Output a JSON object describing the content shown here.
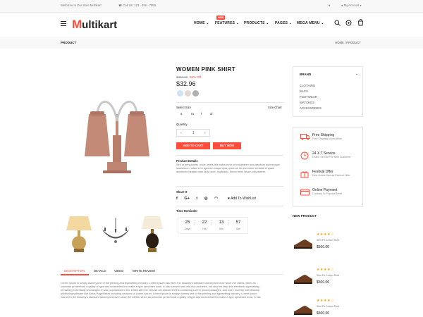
{
  "topbar": {
    "welcome": "Welcome to Our store Multikart",
    "phone": "Call Us: 123 - 456 - 7890",
    "account": "My Account"
  },
  "header": {
    "logo_first": "M",
    "logo_rest": "ultikart",
    "nav": [
      "HOME",
      "FEATURES",
      "PRODUCTS",
      "PAGES",
      "MEGA MENU"
    ],
    "new_badge": "NEW"
  },
  "breadcrumb": {
    "title": "PRODUCT",
    "path": "HOME / PRODUCT"
  },
  "product": {
    "title": "WOMEN PINK SHIRT",
    "old_price": "$459.00",
    "discount": "55% Off",
    "price": "$32.96",
    "colors": [
      "#cfe3f5",
      "#e3d8d2",
      "#b0b0b0"
    ],
    "select_size_label": "Select Size",
    "size_chart_label": "Size Chart",
    "sizes": [
      "s",
      "m",
      "l",
      "xl"
    ],
    "quantity_label": "Quantity",
    "quantity_value": "1",
    "add_to_cart": "ADD TO CART",
    "buy_now": "BUY NOW",
    "details_title": "Product Details",
    "details_text": "Sed ut perspiciatis, unde omnis iste natus error sit voluptatem accusantium doloremque laudantium, totam rem aperiam eaque ipsa, quae ab illo inventore veritatis et quasi architecto beatae vitae dicta sunt, explicabo. Nemo enim ipsam voluptatem,",
    "share_label": "Share It",
    "wishlist": "Add To WishList",
    "time_reminder": "Time Reminder",
    "timer": [
      {
        "value": "25",
        "unit": "Days"
      },
      {
        "value": "22",
        "unit": "Hrs"
      },
      {
        "value": "13",
        "unit": "Min"
      },
      {
        "value": "57",
        "unit": "Sec"
      }
    ]
  },
  "tabs": [
    "DESCRIPTION",
    "DETAILS",
    "VIDEO",
    "WRITE REVIEW"
  ],
  "description": [
    "Lorem Ipsum is simply dummy text of the printing and typesetting industry. Lorem Ipsum has been the industry's standard dummy text ever since the 1500s, when an",
    "unknown printer took a galley of type and scrambled it to make a type specimen book. It has survived not only five centuries, but also the leap into electronic typesetting,",
    "remaining essentially unchanged. It was popularised in the 1960s with the release of Letraset sheets containing Lorem Ipsum passages, and more recently with desktop",
    "publishing software like Aldus PageMaker including versions of Lorem Ipsum. Lorem Ipsum is simply dummy text of the printing and typesetting industry. Lorem Ipsum",
    "has been the industry's standard dummy text ever since the 1500s, when an unknown printer took a galley of type and scrambled it to make a type specimen book. It has"
  ],
  "sidebar": {
    "brand_title": "BRAND",
    "brands": [
      "CLOTHING",
      "BAGS",
      "FOOTWEAR",
      "WATCHES",
      "ACCESSORIES"
    ],
    "services": [
      {
        "title": "Free Shipping",
        "sub": "Free Shipping World Wide"
      },
      {
        "title": "24 X 7 Service",
        "sub": "Online Service For New Customer"
      },
      {
        "title": "Festival Offer",
        "sub": "New Online Special Festival Offer"
      },
      {
        "title": "Online Payment",
        "sub": "Contrary To Popular Belief."
      }
    ],
    "new_product_title": "NEW PRODUCT",
    "new_products": [
      {
        "stars": "★★★★☆",
        "name": "Slim Fit Cotton Shirt",
        "price": "$500.00"
      },
      {
        "stars": "★★★★☆",
        "name": "Slim Fit Cotton Shirt",
        "price": "$500.00"
      },
      {
        "stars": "★★★★☆",
        "name": "Slim Fit Cotton Shirt",
        "price": "$500.00"
      }
    ]
  },
  "colors": {
    "accent": "#ff4c3b",
    "star": "#ffa200"
  }
}
